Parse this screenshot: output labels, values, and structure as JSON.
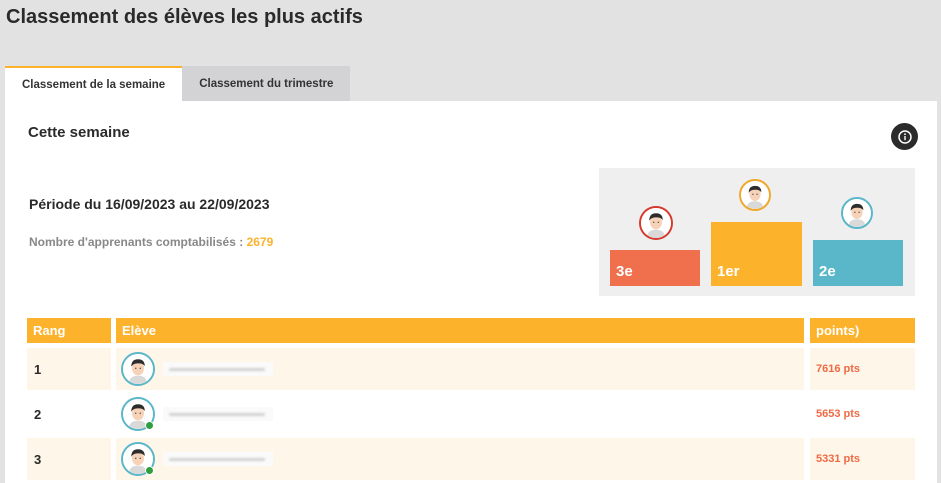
{
  "page": {
    "title": "Classement des élèves les plus actifs"
  },
  "tabs": [
    {
      "label": "Classement de la semaine",
      "active": true
    },
    {
      "label": "Classement du trimestre",
      "active": false
    }
  ],
  "week": {
    "title": "Cette semaine",
    "period": "Période du 16/09/2023 au 22/09/2023",
    "learners_label": "Nombre d'apprenants comptabilisés : ",
    "learners_count": "2679",
    "info_icon": "info-icon"
  },
  "podium": {
    "third": "3e",
    "first": "1er",
    "second": "2e",
    "colors": {
      "third": "#f0704d",
      "first": "#fdb22c",
      "second": "#5ab6c9"
    }
  },
  "table": {
    "headers": {
      "rank": "Rang",
      "student": "Elève",
      "points": "points)"
    },
    "rows": [
      {
        "rank": "1",
        "points": "7616 pts",
        "online": false
      },
      {
        "rank": "2",
        "points": "5653 pts",
        "online": true
      },
      {
        "rank": "3",
        "points": "5331 pts",
        "online": true
      }
    ]
  },
  "colors": {
    "accent": "#fdb22c",
    "points": "#ee6a45",
    "online": "#2e9e3e"
  }
}
